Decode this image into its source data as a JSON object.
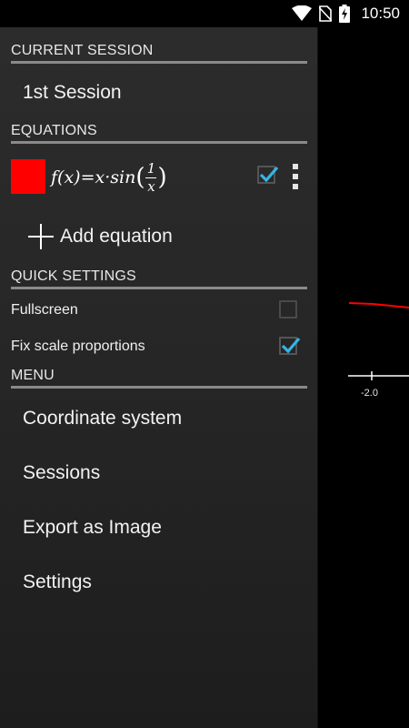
{
  "status_bar": {
    "time": "10:50",
    "icons": [
      "wifi-icon",
      "no-sim-icon",
      "battery-charging-icon"
    ]
  },
  "drawer": {
    "current_session": {
      "header": "CURRENT SESSION",
      "session_name": "1st Session"
    },
    "equations": {
      "header": "EQUATIONS",
      "items": [
        {
          "color": "#ff0000",
          "lhs": "f(x)=x·sin",
          "numerator": "1",
          "denominator": "x",
          "checked": true
        }
      ],
      "add_label": "Add equation"
    },
    "quick_settings": {
      "header": "QUICK SETTINGS",
      "fullscreen": {
        "label": "Fullscreen",
        "checked": false
      },
      "fix_scale": {
        "label": "Fix scale proportions",
        "checked": true
      }
    },
    "menu": {
      "header": "MENU",
      "items": [
        "Coordinate system",
        "Sessions",
        "Export as Image",
        "Settings"
      ]
    }
  },
  "graph": {
    "x_tick_label": "-2.0",
    "curve_color": "#ff0000",
    "accent": "#33b5e5"
  }
}
